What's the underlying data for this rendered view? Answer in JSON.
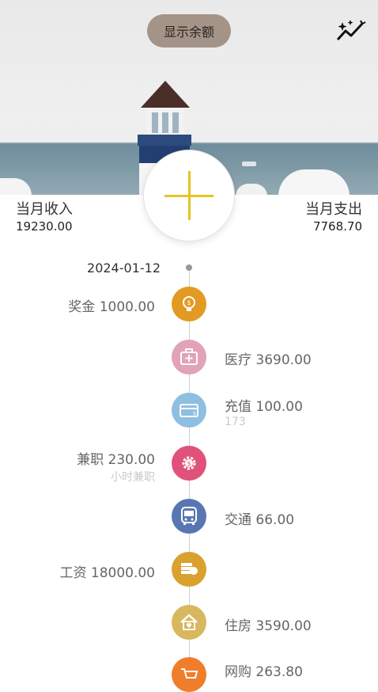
{
  "header": {
    "toggle_balance_label": "显示余额",
    "sparkle_icon": "sparkle-stats-icon"
  },
  "summary": {
    "income_label": "当月收入",
    "income_value": "19230.00",
    "expense_label": "当月支出",
    "expense_value": "7768.70"
  },
  "add_button_icon": "plus-icon",
  "timeline": {
    "date": "2024-01-12",
    "entries": [
      {
        "side": "left",
        "label": "奖金 1000.00",
        "note": "",
        "icon": "bulb-money-icon",
        "color": "#e39a22"
      },
      {
        "side": "right",
        "label": "医疗 3690.00",
        "note": "",
        "icon": "medical-kit-icon",
        "color": "#e2a2b8"
      },
      {
        "side": "right",
        "label": "充值 100.00",
        "note": "173",
        "icon": "card-icon",
        "color": "#8ebfe0"
      },
      {
        "side": "left",
        "label": "兼职 230.00",
        "note": "小时兼职",
        "icon": "gear-money-icon",
        "color": "#e0527a"
      },
      {
        "side": "right",
        "label": "交通 66.00",
        "note": "",
        "icon": "bus-icon",
        "color": "#5877b2"
      },
      {
        "side": "left",
        "label": "工资 18000.00",
        "note": "",
        "icon": "money-stack-icon",
        "color": "#d9a22e"
      },
      {
        "side": "right",
        "label": "住房 3590.00",
        "note": "",
        "icon": "house-icon",
        "color": "#d8b85e"
      },
      {
        "side": "right",
        "label": "网购 263.80",
        "note": "",
        "icon": "cart-icon",
        "color": "#ef7d2a"
      }
    ]
  }
}
